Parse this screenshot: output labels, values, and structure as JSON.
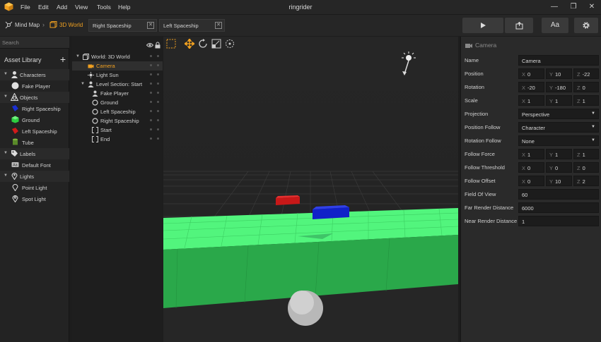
{
  "app": {
    "title": "ringrider",
    "menu": [
      "File",
      "Edit",
      "Add",
      "View",
      "Tools",
      "Help"
    ],
    "accent_color": "#f0a020"
  },
  "toolbar": {
    "breadcrumb": [
      {
        "label": "Mind Map",
        "icon": "mindmap-icon"
      },
      {
        "label": "3D World",
        "icon": "world-cube-icon"
      }
    ],
    "tabs": [
      {
        "label": "Right Spaceship"
      },
      {
        "label": "Left Spaceship"
      }
    ],
    "buttons": [
      {
        "icon": "play-icon"
      },
      {
        "icon": "export-icon"
      },
      {
        "label": "Aa"
      },
      {
        "icon": "gear-icon"
      }
    ]
  },
  "asset_library": {
    "search_placeholder": "Search",
    "title": "Asset Library",
    "categories": [
      {
        "label": "Characters",
        "items": [
          "Fake Player"
        ]
      },
      {
        "label": "Objects",
        "items": [
          "Right Spaceship",
          "Ground",
          "Left Spaceship",
          "Tube"
        ]
      },
      {
        "label": "Labels",
        "items": [
          "Default Font"
        ]
      },
      {
        "label": "Lights",
        "items": [
          "Point Light",
          "Spot Light"
        ]
      }
    ]
  },
  "scene_tree": {
    "rows": [
      {
        "label": "World: 3D World"
      },
      {
        "label": "Camera",
        "selected": true
      },
      {
        "label": "Light Sun"
      },
      {
        "label": "Level Section: Start"
      },
      {
        "label": "Fake Player"
      },
      {
        "label": "Ground"
      },
      {
        "label": "Left Spaceship"
      },
      {
        "label": "Right Spaceship"
      },
      {
        "label": "Start"
      },
      {
        "label": "End"
      }
    ]
  },
  "inspector": {
    "header": "Camera",
    "props": {
      "name": {
        "label": "Name",
        "value": "Camera"
      },
      "position": {
        "label": "Position",
        "x": "0",
        "y": "10",
        "z": "-22"
      },
      "rotation": {
        "label": "Rotation",
        "x": "-20",
        "y": "-180",
        "z": "0"
      },
      "scale": {
        "label": "Scale",
        "x": "1",
        "y": "1",
        "z": "1"
      },
      "projection": {
        "label": "Projection",
        "value": "Perspective"
      },
      "position_follow": {
        "label": "Position Follow",
        "value": "Character"
      },
      "rotation_follow": {
        "label": "Rotation Follow",
        "value": "None"
      },
      "follow_force": {
        "label": "Follow Force",
        "x": "1",
        "y": "1",
        "z": "1"
      },
      "follow_threshold": {
        "label": "Follow Threshold",
        "x": "0",
        "y": "0",
        "z": "0"
      },
      "follow_offset": {
        "label": "Follow Offset",
        "x": "0",
        "y": "10",
        "z": "2"
      },
      "field_of_view": {
        "label": "Field Of View",
        "value": "60"
      },
      "far_render": {
        "label": "Far Render Distance",
        "value": "6000"
      },
      "near_render": {
        "label": "Near Render Distance",
        "value": "1"
      }
    },
    "axis_labels": {
      "x": "X",
      "y": "Y",
      "z": "Z"
    }
  }
}
